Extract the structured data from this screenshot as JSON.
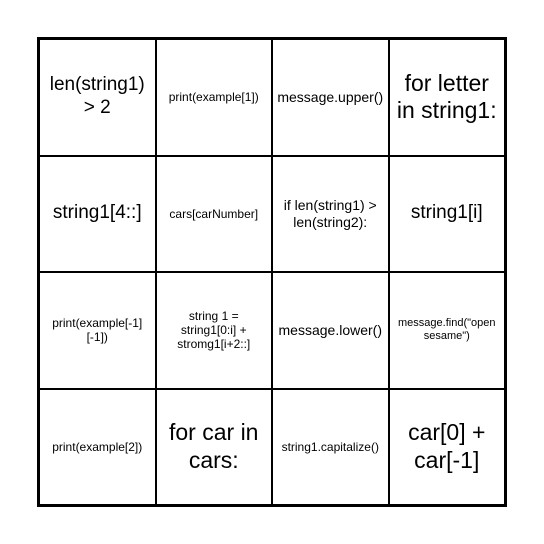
{
  "grid": {
    "rows": [
      [
        {
          "text": "len(string1) > 2",
          "size": "lg"
        },
        {
          "text": "print(example[1])",
          "size": "sm"
        },
        {
          "text": "message.upper()",
          "size": "md"
        },
        {
          "text": "for letter in string1:",
          "size": "xl"
        }
      ],
      [
        {
          "text": "string1[4::]",
          "size": "lg"
        },
        {
          "text": "cars[carNumber]",
          "size": "sm"
        },
        {
          "text": "if len(string1) > len(string2):",
          "size": "md"
        },
        {
          "text": "string1[i]",
          "size": "lg"
        }
      ],
      [
        {
          "text": "print(example[-1][-1])",
          "size": "sm"
        },
        {
          "text": "string 1 = string1[0:i] + stromg1[i+2::]",
          "size": "sm"
        },
        {
          "text": "message.lower()",
          "size": "md"
        },
        {
          "text": "message.find(\"open sesame\")",
          "size": "xs"
        }
      ],
      [
        {
          "text": "print(example[2])",
          "size": "sm"
        },
        {
          "text": "for car in cars:",
          "size": "xl"
        },
        {
          "text": "string1.capitalize()",
          "size": "sm"
        },
        {
          "text": "car[0] + car[-1]",
          "size": "xl"
        }
      ]
    ]
  }
}
